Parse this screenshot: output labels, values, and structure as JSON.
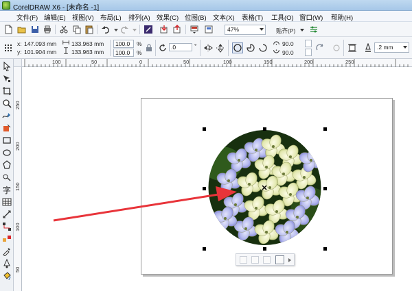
{
  "window": {
    "title": "CorelDRAW X6 - [未命名 -1]"
  },
  "menu": [
    "文件(F)",
    "编辑(E)",
    "视图(V)",
    "布局(L)",
    "排列(A)",
    "效果(C)",
    "位图(B)",
    "文本(X)",
    "表格(T)",
    "工具(O)",
    "窗口(W)",
    "帮助(H)"
  ],
  "toolbar": {
    "zoom": "47%",
    "snap_label": "贴齐(P)"
  },
  "property_bar": {
    "x_label": "x:",
    "x_value": "147.093 mm",
    "y_label": "y:",
    "y_value": "101.904 mm",
    "width_value": "133.963 mm",
    "height_value": "133.963 mm",
    "scale_x": "100.0",
    "scale_y": "100.0",
    "percent": "%",
    "rotation": ".0",
    "degree": "°",
    "arc_start": "90.0",
    "arc_end": "90.0",
    "outline_width": ".2 mm"
  },
  "ruler": {
    "h_labels": [
      "100",
      "50",
      "0",
      "50",
      "100",
      "150",
      "200",
      "250"
    ],
    "v_labels": [
      "250",
      "200",
      "150",
      "100",
      "50"
    ]
  },
  "colors": {
    "arrow": "#e8343a",
    "title_bar": "#bfd9f0",
    "page_border": "#9a9a9a"
  }
}
